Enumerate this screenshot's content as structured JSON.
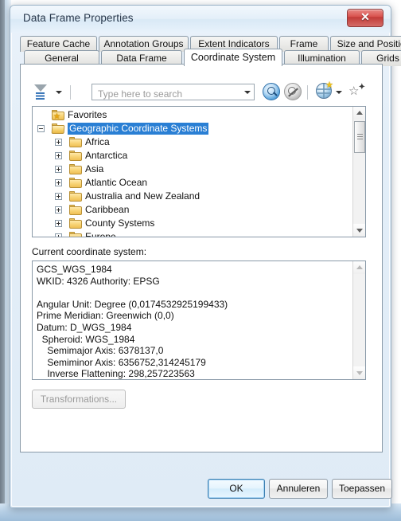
{
  "window": {
    "title": "Data Frame Properties",
    "close_label": "✕"
  },
  "tabs": {
    "row1": [
      {
        "label": "Feature Cache",
        "active": false
      },
      {
        "label": "Annotation Groups",
        "active": false
      },
      {
        "label": "Extent Indicators",
        "active": false
      },
      {
        "label": "Frame",
        "active": false
      },
      {
        "label": "Size and Position",
        "active": false
      }
    ],
    "row2": [
      {
        "label": "General",
        "active": false
      },
      {
        "label": "Data Frame",
        "active": false
      },
      {
        "label": "Coordinate System",
        "active": true
      },
      {
        "label": "Illumination",
        "active": false
      },
      {
        "label": "Grids",
        "active": false
      }
    ]
  },
  "toolbar": {
    "filter_icon": "filter-funnel-icon",
    "filter_dropdown_icon": "chevron-down-icon",
    "search_placeholder": "Type here to search",
    "search_value": "",
    "search_dropdown_icon": "chevron-down-icon",
    "search_button_icon": "magnifier-search-icon",
    "clear_search_button_icon": "magnifier-clear-icon",
    "globe_icon": "globe-favorites-icon",
    "globe_dropdown_icon": "chevron-down-icon",
    "add_favorite_icon": "star-add-icon"
  },
  "tree": {
    "items": [
      {
        "label": "Favorites",
        "indent": 0,
        "expander": "none",
        "icon": "folder-star-icon",
        "selected": false
      },
      {
        "label": "Geographic Coordinate Systems",
        "indent": 0,
        "expander": "minus",
        "icon": "folder-open-icon",
        "selected": true
      },
      {
        "label": "Africa",
        "indent": 1,
        "expander": "plus",
        "icon": "folder-icon",
        "selected": false
      },
      {
        "label": "Antarctica",
        "indent": 1,
        "expander": "plus",
        "icon": "folder-icon",
        "selected": false
      },
      {
        "label": "Asia",
        "indent": 1,
        "expander": "plus",
        "icon": "folder-icon",
        "selected": false
      },
      {
        "label": "Atlantic Ocean",
        "indent": 1,
        "expander": "plus",
        "icon": "folder-icon",
        "selected": false
      },
      {
        "label": "Australia and New Zealand",
        "indent": 1,
        "expander": "plus",
        "icon": "folder-icon",
        "selected": false
      },
      {
        "label": "Caribbean",
        "indent": 1,
        "expander": "plus",
        "icon": "folder-icon",
        "selected": false
      },
      {
        "label": "County Systems",
        "indent": 1,
        "expander": "plus",
        "icon": "folder-icon",
        "selected": false
      },
      {
        "label": "Europe",
        "indent": 1,
        "expander": "plus",
        "icon": "folder-icon",
        "selected": false
      }
    ]
  },
  "details": {
    "label": "Current coordinate system:",
    "text": "GCS_WGS_1984\nWKID: 4326 Authority: EPSG\n\nAngular Unit: Degree (0,0174532925199433)\nPrime Meridian: Greenwich (0,0)\nDatum: D_WGS_1984\n  Spheroid: WGS_1984\n    Semimajor Axis: 6378137,0\n    Semiminor Axis: 6356752,314245179\n    Inverse Flattening: 298,257223563"
  },
  "actions": {
    "transformations_label": "Transformations...",
    "ok_label": "OK",
    "cancel_label": "Annuleren",
    "apply_label": "Toepassen"
  },
  "colors": {
    "selection_blue": "#2a7fd4",
    "title_text": "#26364a",
    "close_red": "#d9534f",
    "folder_yellow": "#f7d272"
  }
}
